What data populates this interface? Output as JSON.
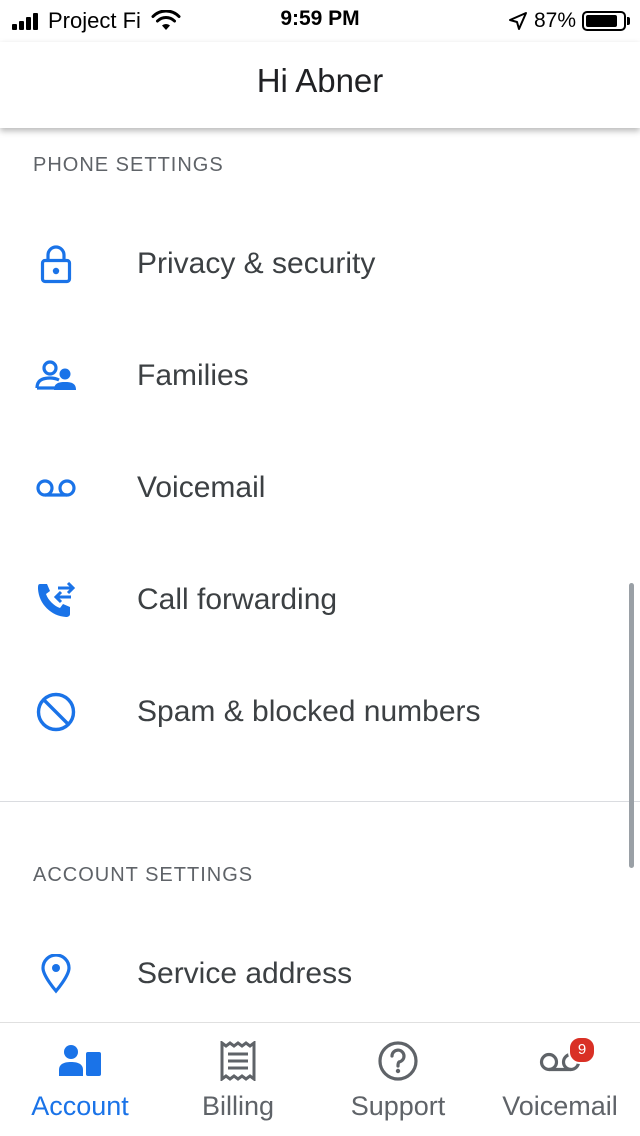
{
  "status_bar": {
    "carrier": "Project Fi",
    "time": "9:59 PM",
    "battery_percent": "87%",
    "battery_level": 0.87,
    "icons": [
      "signal-icon",
      "wifi-icon",
      "location-arrow-icon",
      "battery-icon"
    ]
  },
  "app_bar": {
    "title": "Hi Abner"
  },
  "phone_settings": {
    "header": "PHONE SETTINGS",
    "items": [
      {
        "label": "Privacy & security",
        "icon": "lock-icon"
      },
      {
        "label": "Families",
        "icon": "family-icon"
      },
      {
        "label": "Voicemail",
        "icon": "voicemail-icon"
      },
      {
        "label": "Call forwarding",
        "icon": "call-forward-icon"
      },
      {
        "label": "Spam & blocked numbers",
        "icon": "block-icon"
      }
    ]
  },
  "account_settings": {
    "header": "ACCOUNT SETTINGS",
    "items": [
      {
        "label": "Service address",
        "icon": "location-pin-icon"
      }
    ]
  },
  "bottom_nav": {
    "items": [
      {
        "label": "Account",
        "icon": "account-icon",
        "active": true
      },
      {
        "label": "Billing",
        "icon": "receipt-icon",
        "active": false
      },
      {
        "label": "Support",
        "icon": "help-icon",
        "active": false
      },
      {
        "label": "Voicemail",
        "icon": "voicemail-icon",
        "active": false,
        "badge": "9"
      }
    ]
  },
  "colors": {
    "accent": "#1a73e8",
    "text_primary": "#3c4043",
    "text_secondary": "#5f6368",
    "badge": "#d93025",
    "divider": "#dadce0"
  }
}
